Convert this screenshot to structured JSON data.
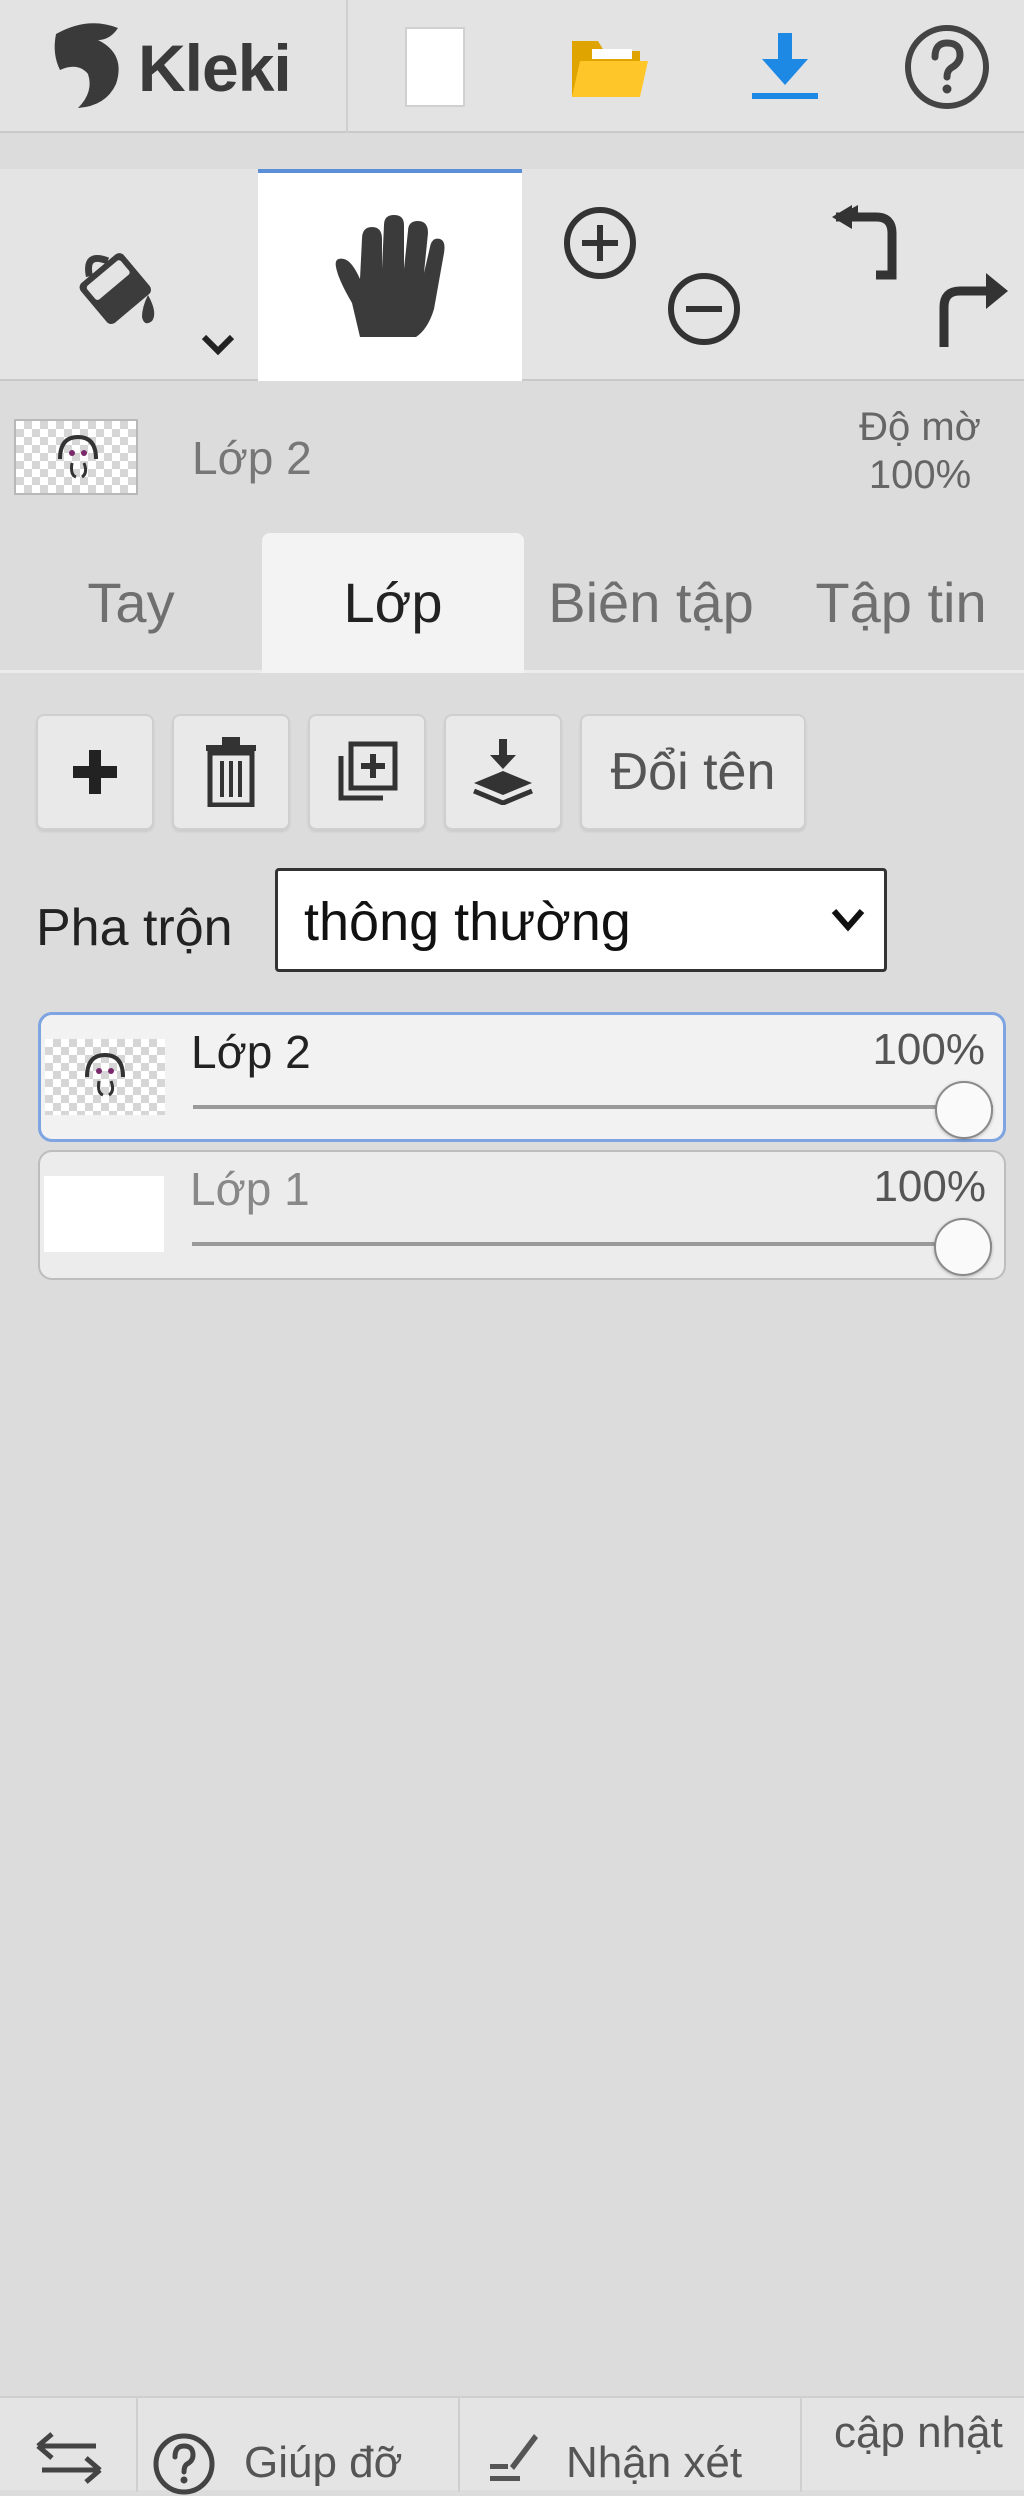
{
  "app": {
    "logo_text": "Kleki"
  },
  "topbar": {
    "icons": [
      "new-file-icon",
      "open-folder-icon",
      "download-icon",
      "help-icon"
    ]
  },
  "toolbar": {
    "tools": [
      "fill-icon",
      "hand-icon",
      "zoom-in-icon",
      "zoom-out-icon",
      "undo-icon",
      "redo-icon"
    ],
    "active_tool": "hand"
  },
  "layer_status": {
    "layer_name": "Lớp 2",
    "opacity_label": "Độ mờ",
    "opacity_value": "100%"
  },
  "tabs": [
    {
      "label": "Tay",
      "active": false
    },
    {
      "label": "Lớp",
      "active": true
    },
    {
      "label": "Biên tập",
      "active": false
    },
    {
      "label": "Tập tin",
      "active": false
    }
  ],
  "layer_panel": {
    "buttons": [
      "add-layer-icon",
      "delete-layer-icon",
      "duplicate-layer-icon",
      "merge-down-icon"
    ],
    "rename_label": "Đổi tên",
    "blend_label": "Pha trộn",
    "blend_value": "thông thường",
    "layers": [
      {
        "name": "Lớp 2",
        "opacity_text": "100%",
        "opacity": 1.0,
        "selected": true
      },
      {
        "name": "Lớp 1",
        "opacity_text": "100%",
        "opacity": 1.0,
        "selected": false
      }
    ]
  },
  "footer": {
    "help_label": "Giúp đỡ",
    "feedback_label": "Nhận xét",
    "update_label": "cập nhật"
  },
  "colors": {
    "accent": "#5b8fd8",
    "download": "#1e88e5",
    "folder": "#f5b800"
  }
}
